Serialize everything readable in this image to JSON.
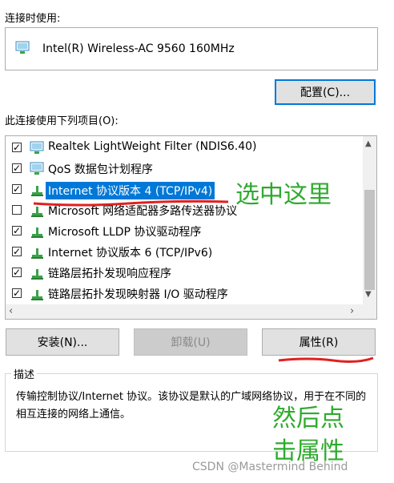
{
  "connect_using_label": "连接时使用:",
  "adapter_name": "Intel(R) Wireless-AC 9560 160MHz",
  "configure_button": "配置(C)...",
  "items_label": "此连接使用下列项目(O):",
  "items": [
    {
      "label": "Realtek LightWeight Filter (NDIS6.40)",
      "checked": true,
      "icon": "network-filter-icon"
    },
    {
      "label": "QoS 数据包计划程序",
      "checked": true,
      "icon": "network-filter-icon"
    },
    {
      "label": "Internet 协议版本 4 (TCP/IPv4)",
      "checked": true,
      "icon": "protocol-icon",
      "selected": true
    },
    {
      "label": "Microsoft 网络适配器多路传送器协议",
      "checked": false,
      "icon": "protocol-icon"
    },
    {
      "label": "Microsoft LLDP 协议驱动程序",
      "checked": true,
      "icon": "protocol-icon"
    },
    {
      "label": "Internet 协议版本 6 (TCP/IPv6)",
      "checked": true,
      "icon": "protocol-icon"
    },
    {
      "label": "链路层拓扑发现响应程序",
      "checked": true,
      "icon": "protocol-icon"
    },
    {
      "label": "链路层拓扑发现映射器 I/O 驱动程序",
      "checked": true,
      "icon": "protocol-icon"
    }
  ],
  "buttons": {
    "install": "安装(N)...",
    "uninstall": "卸载(U)",
    "properties": "属性(R)"
  },
  "description_title": "描述",
  "description_text": "传输控制协议/Internet 协议。该协议是默认的广域网络协议，用于在不同的相互连接的网络上通信。",
  "annotations": {
    "select_here": "选中这里",
    "then_click_line1": "然后点",
    "then_click_line2": "击属性"
  },
  "watermark": "CSDN @Mastermind Behind",
  "colors": {
    "selection": "#0078d7",
    "annotation_green": "#2eaa2e",
    "annotation_red": "#e02020"
  }
}
